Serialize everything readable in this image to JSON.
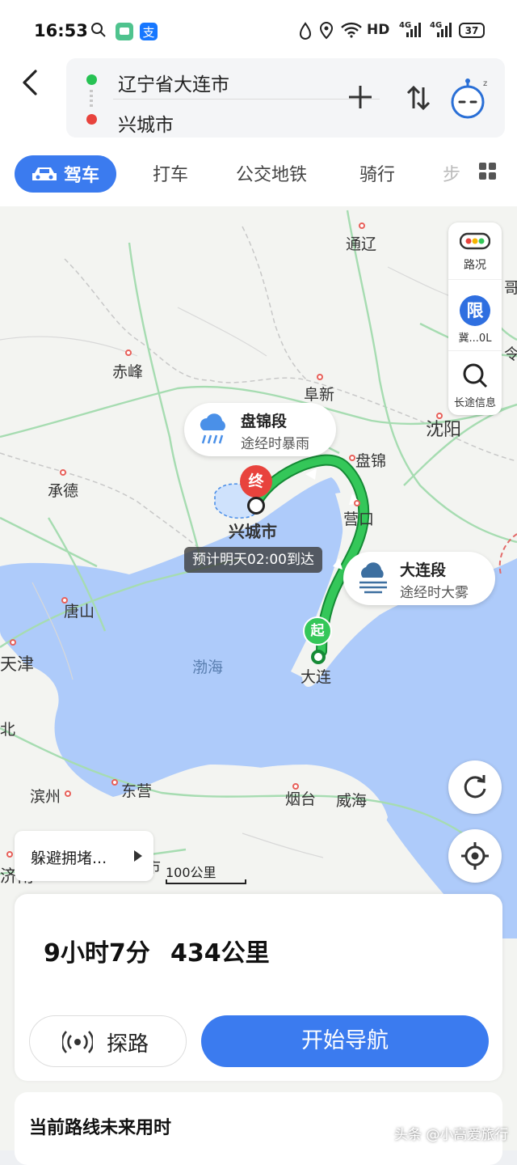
{
  "status_bar": {
    "time": "16:53",
    "network": "HD",
    "signal1": "4G",
    "signal2": "4G",
    "battery": "37"
  },
  "route": {
    "origin": "辽宁省大连市",
    "destination": "兴城市"
  },
  "tabs": [
    {
      "label": "驾车",
      "active": true
    },
    {
      "label": "打车"
    },
    {
      "label": "公交地铁"
    },
    {
      "label": "骑行"
    },
    {
      "label": "步"
    }
  ],
  "map": {
    "labels": {
      "tongliao": "通辽",
      "chifeng": "赤峰",
      "fuxin": "阜新",
      "shenyang": "沈阳",
      "panjin": "盘锦",
      "chengde": "承德",
      "yingkou": "营口",
      "xingcheng": "兴城市",
      "tangshan": "唐山",
      "tianjin": "天津",
      "bohai": "渤海",
      "dalian": "大连",
      "binzhou": "滨州",
      "dongying": "东营",
      "yantai": "烟台",
      "weihai": "威海",
      "jinan": "济南",
      "edge_right": "哥",
      "edge_right2": "令",
      "edge_left": "北",
      "edge_bottom": "市"
    },
    "controls": {
      "traffic": "路况",
      "restrict_badge": "限",
      "restrict": "冀...0L",
      "long_trip": "长途信息"
    },
    "weather_panjin": {
      "title": "盘锦段",
      "subtitle": "途经时暴雨"
    },
    "weather_dalian": {
      "title": "大连段",
      "subtitle": "途经时大雾"
    },
    "end_marker": "终",
    "start_marker": "起",
    "eta": "预计明天02:00到达",
    "avoid": "躲避拥堵...",
    "scale": "100公里"
  },
  "summary": {
    "duration": "9小时7分",
    "distance": "434公里",
    "explore": "探路",
    "start_nav": "开始导航"
  },
  "future": {
    "title": "当前路线未来用时"
  },
  "watermark": "头条 @小高爱旅行",
  "colors": {
    "accent": "#3b7bef",
    "route": "#27c254",
    "water": "#aecbfa",
    "land": "#f3f4f1"
  }
}
